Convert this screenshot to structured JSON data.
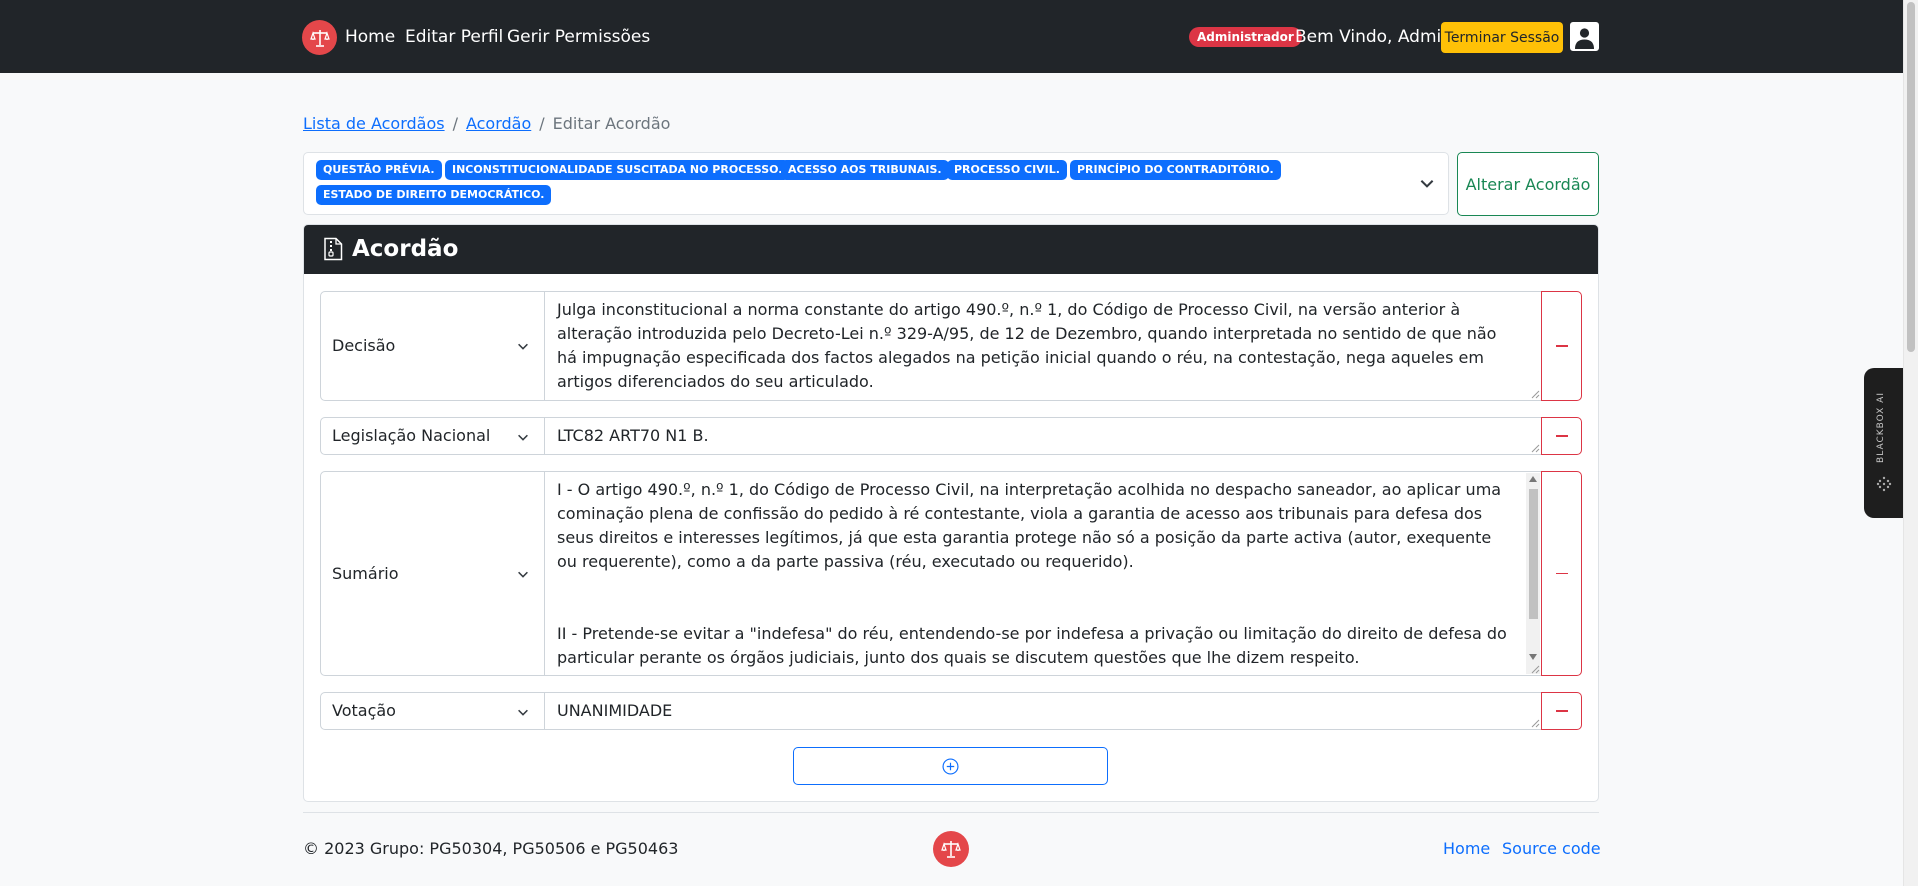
{
  "navbar": {
    "links": [
      "Home",
      "Editar Perfil",
      "Gerir Permissões"
    ],
    "role_badge": "Administrador",
    "welcome": "Bem Vindo, Admin!",
    "logout_label": "Terminar Sessão",
    "colors": {
      "background": "#212529",
      "logo": "#e4474a",
      "badge": "#dc3545",
      "logout": "#ffc107"
    }
  },
  "breadcrumb": {
    "items": [
      "Lista de Acordãos",
      "Acordão"
    ],
    "current": "Editar Acordão"
  },
  "tags": {
    "selected": [
      "QUESTÃO PRÉVIA.",
      "INCONSTITUCIONALIDADE SUSCITADA NO PROCESSO.",
      "ACESSO AOS TRIBUNAIS.",
      "PROCESSO CIVIL.",
      "PRINCÍPIO DO CONTRADITÓRIO.",
      "ESTADO DE DIREITO DEMOCRÁTICO."
    ],
    "alter_button": "Alterar Acordão"
  },
  "card": {
    "title": "Acordão",
    "fields": [
      {
        "label": "Decisão",
        "value": "Julga inconstitucional a norma constante do artigo 490.º, n.º 1, do Código de Processo Civil, na versão anterior à alteração introduzida pelo Decreto-Lei n.º 329-A/95, de 12 de Dezembro, quando interpretada no sentido de que não há impugnação especificada dos factos alegados na petição inicial quando o réu, na contestação, nega aqueles em artigos diferenciados do seu articulado."
      },
      {
        "label": "Legislação Nacional",
        "value": "LTC82 ART70 N1 B."
      },
      {
        "label": "Sumário",
        "paragraphs": [
          "I - O artigo 490.º, n.º 1, do Código de Processo Civil, na interpretação acolhida no despacho saneador, ao aplicar uma cominação plena de confissão do pedido à ré contestante, viola a garantia de acesso aos tribunais para defesa dos seus direitos e interesses legítimos, já que esta garantia protege não só a posição da parte activa (autor, exequente ou requerente), como a da parte passiva (réu, executado ou requerido).",
          "II - Pretende-se evitar a \"indefesa\" do réu, entendendo-se por indefesa a privação ou limitação do direito de defesa do particular perante os órgãos judiciais, junto dos quais se discutem questões que lhe dizem respeito."
        ]
      },
      {
        "label": "Votação",
        "value": "UNANIMIDADE"
      }
    ]
  },
  "footer": {
    "copyright": "© 2023 Grupo: PG50304, PG50506 e PG50463",
    "links": [
      "Home",
      "Source code"
    ]
  },
  "widget": {
    "label": "BLACKBOX AI"
  },
  "colors": {
    "primary": "#0d6efd",
    "success": "#198754",
    "danger": "#dc3545"
  }
}
